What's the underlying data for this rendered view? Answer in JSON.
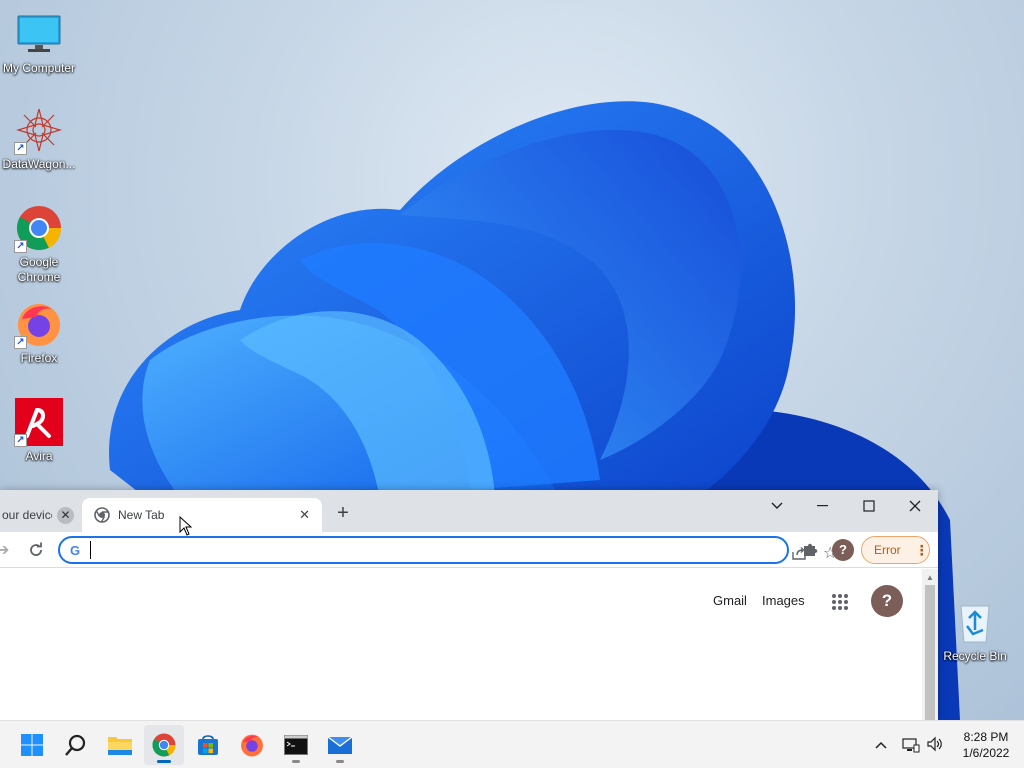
{
  "desktop": {
    "icons": [
      {
        "label": "My Computer",
        "icon": "monitor-icon"
      },
      {
        "label": "DataWagon...",
        "icon": "datawagon-icon"
      },
      {
        "label": "Google Chrome",
        "icon": "chrome-icon"
      },
      {
        "label": "Firefox",
        "icon": "firefox-icon"
      },
      {
        "label": "Avira",
        "icon": "avira-icon"
      },
      {
        "label": "Recycle Bin",
        "icon": "recycle-bin-icon"
      }
    ]
  },
  "browser": {
    "tabs": [
      {
        "title": "our device",
        "close": "✕"
      },
      {
        "title": "New Tab",
        "close": "✕"
      }
    ],
    "new_tab": "+",
    "window_controls": {
      "dropdown": "⌄",
      "minimize": "—",
      "maximize": "☐",
      "close": "✕"
    },
    "omnibox": {
      "value": "",
      "placeholder": ""
    },
    "error_chip": {
      "label": "Error",
      "menu": "⋮"
    },
    "profile_initial": "?",
    "ntp": {
      "gmail": "Gmail",
      "images": "Images",
      "account_initial": "?"
    }
  },
  "taskbar": {
    "apps": [
      "start-icon",
      "search-icon",
      "file-explorer-icon",
      "chrome-icon",
      "store-icon",
      "firefox-icon",
      "terminal-icon",
      "mail-icon"
    ],
    "clock": {
      "time": "8:28 PM",
      "date": "1/6/2022"
    }
  },
  "colors": {
    "accent": "#1a73e8",
    "taskbar": "#f3f3f3",
    "error_chip": "#b55b12"
  }
}
